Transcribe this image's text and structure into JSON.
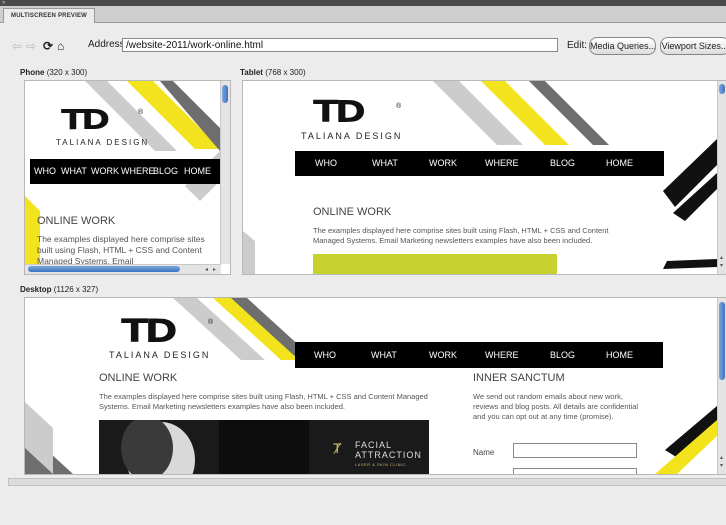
{
  "panel": {
    "tab_label": "MULTISCREEN PREVIEW"
  },
  "toolbar": {
    "address_label": "Address:",
    "address_value": "/website-2011/work-online.html",
    "edit_label": "Edit:",
    "media_queries_label": "Media Queries...",
    "viewport_sizes_label": "Viewport Sizes..."
  },
  "site": {
    "logo_mark": "TD",
    "logo_registered": "®",
    "logo_name": "TALIANA DESIGN",
    "nav": [
      "WHO",
      "WHAT",
      "WORK",
      "WHERE",
      "BLOG",
      "HOME"
    ],
    "page_heading": "ONLINE WORK",
    "page_text": "The examples displayed here comprise sites built using Flash, HTML + CSS and Content Managed Systems. Email Marketing newsletters examples have also been included.",
    "phone_text_visible": "The examples displayed here comprise sites built using Flash, HTML + CSS and Content Managed Systems. Email",
    "desktop_text": "The examples displayed here comprise sites built using Flash, HTML + CSS and Content Managed Systems. Email Marketing newsletters examples have also been included.",
    "sidebar_heading": "INNER SANCTUM",
    "sidebar_text": "We send out random emails about new work, reviews and blog posts. All details are confidential and you can opt out at any time (promise).",
    "form_name_label": "Name",
    "banner_title_1": "FACIAL",
    "banner_title_2": "ATTRACTION",
    "banner_subtitle": "LASER & SKIN CLINIC"
  },
  "viewports": {
    "phone": {
      "name": "Phone",
      "size": "(320 x 300)"
    },
    "tablet": {
      "name": "Tablet",
      "size": "(768 x 300)"
    },
    "desktop": {
      "name": "Desktop",
      "size": "(1126 x 327)"
    }
  },
  "colors": {
    "stripe_yellow": "#f2e31c",
    "stripe_gray": "#cccccc",
    "stripe_dark": "#6e6e6e",
    "nav_black": "#000000",
    "scroll_blue": "#3b74c4",
    "content_bar_green": "#c7d130"
  },
  "icons": {
    "back": "back-arrow-icon",
    "forward": "forward-arrow-icon",
    "refresh": "refresh-icon",
    "home": "home-icon"
  }
}
